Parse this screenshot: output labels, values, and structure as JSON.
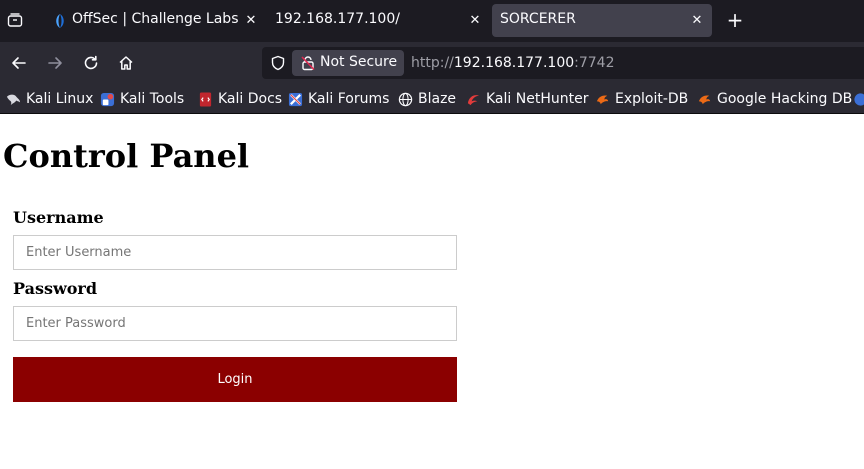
{
  "browser": {
    "tabs": [
      {
        "label": "OffSec | Challenge Labs",
        "icon": "offsec-icon"
      },
      {
        "label": "192.168.177.100/"
      },
      {
        "label": "SORCERER",
        "active": true
      }
    ],
    "new_tab_label": "+",
    "close_glyph": "✕",
    "security_label": "Not Secure",
    "url": {
      "scheme": "http://",
      "host": "192.168.177.100",
      "port": ":7742"
    },
    "bookmarks": [
      {
        "label": "Kali Linux",
        "icon": "kali-linux-icon"
      },
      {
        "label": "Kali Tools",
        "icon": "kali-tools-icon"
      },
      {
        "label": "Kali Docs",
        "icon": "kali-docs-icon"
      },
      {
        "label": "Kali Forums",
        "icon": "kali-forums-icon"
      },
      {
        "label": "Blaze",
        "icon": "globe-icon"
      },
      {
        "label": "Kali NetHunter",
        "icon": "kali-nethunter-icon"
      },
      {
        "label": "Exploit-DB",
        "icon": "exploit-db-icon"
      },
      {
        "label": "Google Hacking DB",
        "icon": "ghdb-icon"
      }
    ]
  },
  "page": {
    "title": "Control Panel",
    "username_label": "Username",
    "username_placeholder": "Enter Username",
    "password_label": "Password",
    "password_placeholder": "Enter Password",
    "login_label": "Login"
  },
  "colors": {
    "tabbar_bg": "#1c1b22",
    "toolbar_bg": "#2b2a33",
    "active_tab_bg": "#42414d",
    "login_button": "#8b0000"
  }
}
